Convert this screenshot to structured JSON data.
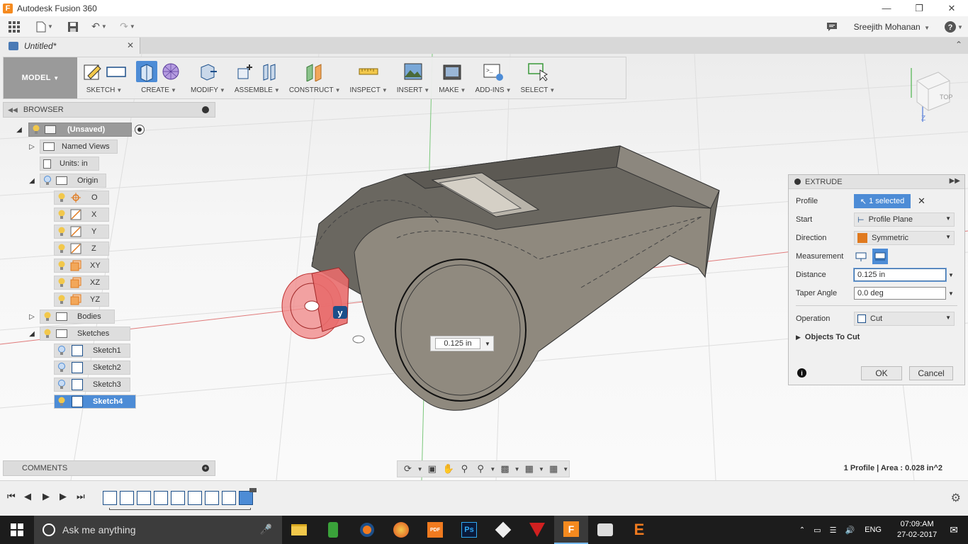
{
  "window": {
    "title": "Autodesk Fusion 360"
  },
  "appbar": {
    "user": "Sreejith Mohanan"
  },
  "tab": {
    "title": "Untitled*"
  },
  "toolbar": {
    "workspace": "MODEL",
    "groups": [
      {
        "label": "SKETCH"
      },
      {
        "label": "CREATE"
      },
      {
        "label": "MODIFY"
      },
      {
        "label": "ASSEMBLE"
      },
      {
        "label": "CONSTRUCT"
      },
      {
        "label": "INSPECT"
      },
      {
        "label": "INSERT"
      },
      {
        "label": "MAKE"
      },
      {
        "label": "ADD-INS"
      },
      {
        "label": "SELECT"
      }
    ]
  },
  "browser": {
    "header": "BROWSER",
    "root": "(Unsaved)",
    "named_views": "Named Views",
    "units": "Units: in",
    "origin": "Origin",
    "origin_items": [
      "O",
      "X",
      "Y",
      "Z",
      "XY",
      "XZ",
      "YZ"
    ],
    "bodies": "Bodies",
    "sketches": "Sketches",
    "sketch_items": [
      "Sketch1",
      "Sketch2",
      "Sketch3",
      "Sketch4"
    ]
  },
  "comments": {
    "header": "COMMENTS"
  },
  "viewcube": {
    "face": "TOP",
    "axis_z": "Z"
  },
  "viewport": {
    "distance_tag": "0.125 in"
  },
  "extrude": {
    "title": "EXTRUDE",
    "rows": {
      "profile_label": "Profile",
      "profile_value": "1 selected",
      "start_label": "Start",
      "start_value": "Profile Plane",
      "direction_label": "Direction",
      "direction_value": "Symmetric",
      "measurement_label": "Measurement",
      "distance_label": "Distance",
      "distance_value": "0.125 in",
      "taper_label": "Taper Angle",
      "taper_value": "0.0 deg",
      "operation_label": "Operation",
      "operation_value": "Cut",
      "objects_label": "Objects To Cut"
    },
    "ok": "OK",
    "cancel": "Cancel"
  },
  "status": {
    "text": "1 Profile | Area : 0.028 in^2"
  },
  "taskbar": {
    "search_placeholder": "Ask me anything",
    "language": "ENG",
    "time": "07:09:AM",
    "date": "27-02-2017"
  },
  "colors": {
    "accent": "#4d8cd6",
    "body": "#8a8378",
    "profile": "#e86c6c",
    "taskbar": "#1c1c1c"
  }
}
